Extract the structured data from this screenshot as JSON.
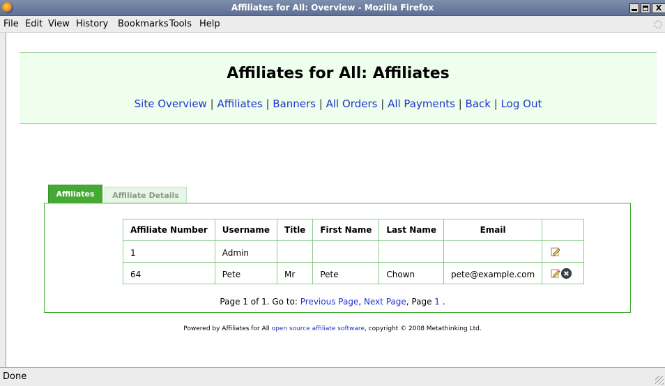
{
  "window": {
    "title": "Affiliates for All: Overview - Mozilla Firefox",
    "icon": "firefox-icon",
    "controls": [
      "minimize",
      "maximize",
      "close"
    ],
    "close_glyph": "X"
  },
  "menubar": {
    "items": [
      {
        "label": "File"
      },
      {
        "label": "Edit"
      },
      {
        "label": "View"
      },
      {
        "label": "History"
      },
      {
        "label": "Bookmarks"
      },
      {
        "label": "Tools"
      },
      {
        "label": "Help"
      }
    ]
  },
  "header": {
    "title": "Affiliates for All: Affiliates",
    "nav": [
      {
        "label": "Site Overview"
      },
      {
        "label": "Affiliates"
      },
      {
        "label": "Banners"
      },
      {
        "label": "All Orders"
      },
      {
        "label": "All Payments"
      },
      {
        "label": "Back"
      },
      {
        "label": "Log Out"
      }
    ],
    "separator": "|"
  },
  "tabs": [
    {
      "label": "Affiliates",
      "active": true
    },
    {
      "label": "Affiliate Details",
      "active": false
    }
  ],
  "table": {
    "columns": [
      "Affiliate Number",
      "Username",
      "Title",
      "First Name",
      "Last Name",
      "Email",
      ""
    ],
    "rows": [
      {
        "number": "1",
        "username": "Admin",
        "title": "",
        "first_name": "",
        "last_name": "",
        "email": "",
        "actions": [
          "edit-icon"
        ]
      },
      {
        "number": "64",
        "username": "Pete",
        "title": "Mr",
        "first_name": "Pete",
        "last_name": "Chown",
        "email": "pete@example.com",
        "actions": [
          "edit-icon",
          "delete-icon"
        ]
      }
    ]
  },
  "pager": {
    "prefix": "Page 1 of 1. Go to: ",
    "previous": "Previous Page",
    "comma1": ", ",
    "next": "Next Page",
    "mid": ", Page ",
    "page_link": "1",
    "suffix": " ."
  },
  "footer": {
    "prefix": "Powered by Affiliates for All ",
    "link": "open source affiliate software",
    "suffix": ", copyright © 2008 Metathinking Ltd."
  },
  "status": {
    "text": "Done"
  },
  "colors": {
    "title_bar": "#5d6f93",
    "header_bg": "#eeffee",
    "tab_active": "#44aa33",
    "link": "#2233cc",
    "table_border": "#88cc88"
  }
}
